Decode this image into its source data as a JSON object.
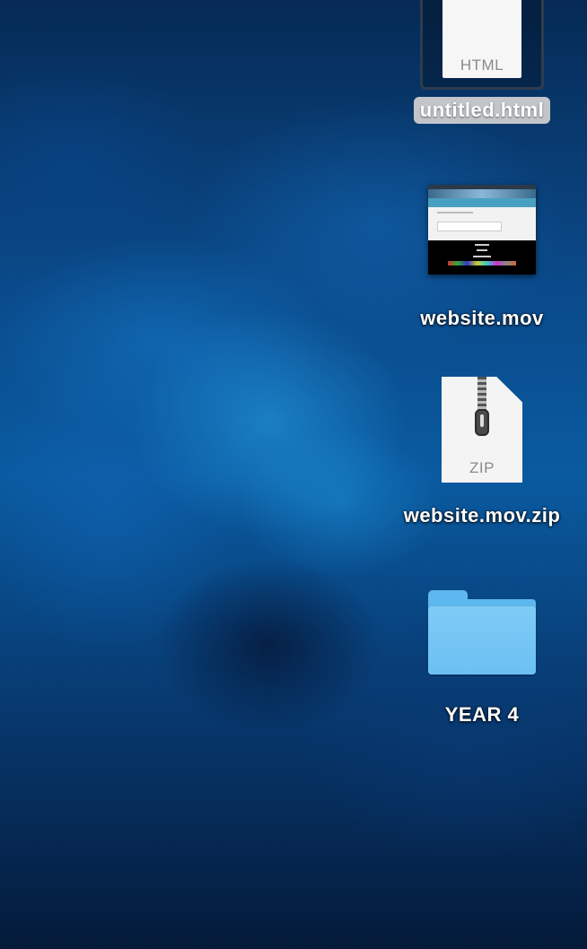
{
  "desktop": {
    "items": [
      {
        "label": "untitled.html",
        "kind": "html-document",
        "type_text": "HTML",
        "selected": true
      },
      {
        "label": "website.mov",
        "kind": "movie"
      },
      {
        "label": "website.mov.zip",
        "kind": "zip-archive",
        "type_text": "ZIP"
      },
      {
        "label": "YEAR 4",
        "kind": "folder"
      }
    ]
  },
  "colors": {
    "folder": "#6bc0f3",
    "selection_label": "#d2d2d2",
    "wallpaper_dark": "#041a3a",
    "wallpaper_mid": "#0a5aa0"
  }
}
